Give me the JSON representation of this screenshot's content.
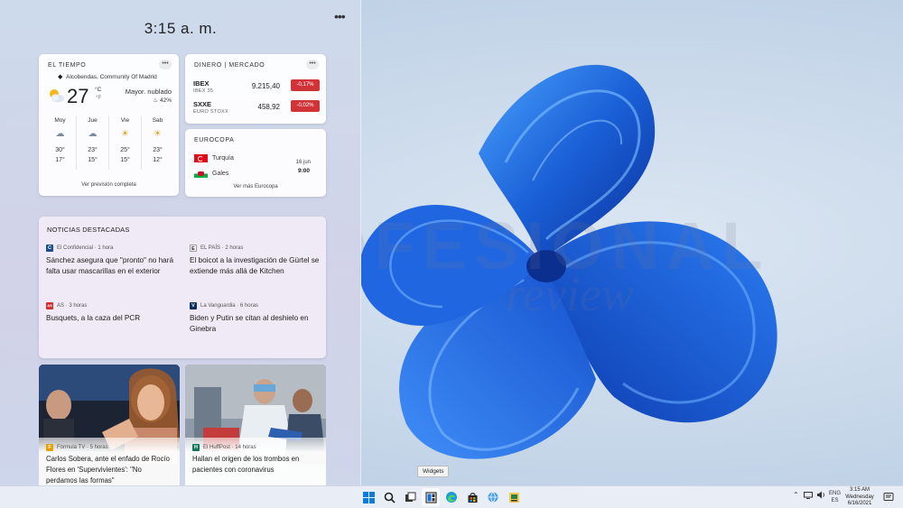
{
  "panel": {
    "time": "3:15 a. m.",
    "more": "•••"
  },
  "weather": {
    "title": "EL TIEMPO",
    "menu": "•••",
    "location": "Alcobendas, Community Of Madrid",
    "temp": "27",
    "unit_c": "°C",
    "unit_f": "°F",
    "condition": "Mayor. nublado",
    "humidity": "♨ 42%",
    "forecast": [
      {
        "day": "Moy",
        "hi": "30°",
        "lo": "17°"
      },
      {
        "day": "Jue",
        "hi": "23°",
        "lo": "15°"
      },
      {
        "day": "Vie",
        "hi": "25°",
        "lo": "15°"
      },
      {
        "day": "Sab",
        "hi": "23°",
        "lo": "12°"
      }
    ],
    "link": "Ver previsión completa"
  },
  "market": {
    "title": "DINERO | MERCADO",
    "menu": "•••",
    "stocks": [
      {
        "symbol": "IBEX",
        "name": "IBEX 35",
        "value": "9.215,40",
        "change": "-0,17%"
      },
      {
        "symbol": "SXXE",
        "name": "EURO STOXX",
        "value": "458,92",
        "change": "-0,02%"
      }
    ],
    "change_color": "#d13438"
  },
  "euro": {
    "title": "EUROCOPA",
    "team1": "Turquía",
    "team2": "Gales",
    "date": "16 jun",
    "time": "9:00",
    "link": "Ver más Eurocopa"
  },
  "news": {
    "title": "NOTICIAS DESTACADAS",
    "stories": [
      {
        "logo": "C",
        "source": "El Confidencial · 1 hora",
        "headline": "Sánchez asegura que \"pronto\" no hará falta usar mascarillas en el exterior"
      },
      {
        "logo": "E",
        "source": "EL PAÍS · 2 horas",
        "headline": "El boicot a la investigación de Gürtel se extiende más allá de Kitchen"
      },
      {
        "logo": "AS",
        "source": "AS · 3 horas",
        "headline": "Busquets, a la caza del PCR"
      },
      {
        "logo": "V",
        "source": "La Vanguardia · 6 horas",
        "headline": "Biden y Putin se citan al deshielo en Ginebra"
      }
    ]
  },
  "photos": [
    {
      "logo": "F",
      "source": "Fórmula TV · 5 horas",
      "headline": "Carlos Sobera, ante el enfado de Rocío Flores en 'Supervivientes': \"No perdamos las formas\""
    },
    {
      "logo": "H",
      "source": "El HuffPost · 14 horas",
      "headline": "Hallan el origen de los trombos en pacientes con coronavirus"
    }
  ],
  "watermark": {
    "line1": "PROFESIONAL",
    "line2": "review"
  },
  "tooltip": "Widgets",
  "taskbar": {
    "lang1": "ENG",
    "lang2": "ES",
    "clock_time": "3:15 AM",
    "clock_day": "Wednesday",
    "clock_date": "6/16/2021",
    "icons": [
      "start-icon",
      "search-icon",
      "task-view-icon",
      "widgets-icon",
      "edge-icon",
      "store-icon",
      "network-globe-icon",
      "app-icon"
    ]
  },
  "colors": {
    "accent": "#0067c0",
    "wallpaper_blue": "#1a5fd6"
  }
}
